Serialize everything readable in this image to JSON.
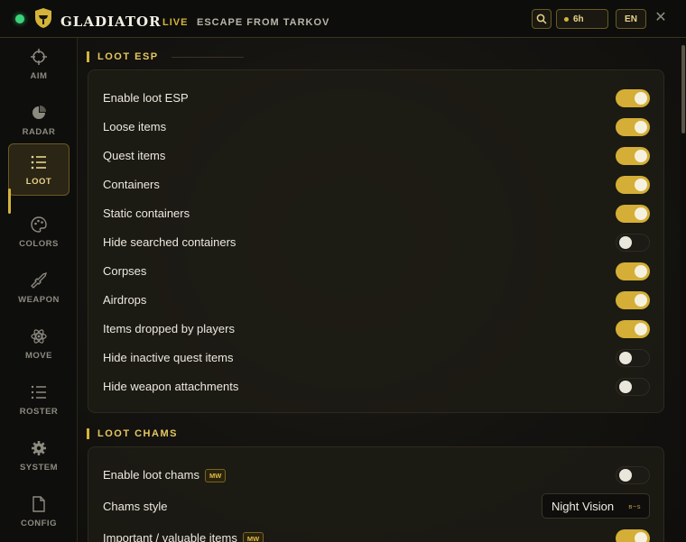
{
  "header": {
    "brand": "GLADIATOR",
    "status": "LIVE",
    "game": "ESCAPE FROM TARKOV",
    "time": "6h",
    "language": "EN",
    "close_glyph": "✕"
  },
  "sidebar": {
    "items": [
      {
        "label": "AIM",
        "icon": "crosshair-icon"
      },
      {
        "label": "RADAR",
        "icon": "radar-icon"
      },
      {
        "label": "LOOT",
        "icon": "list-icon"
      },
      {
        "label": "COLORS",
        "icon": "palette-icon"
      },
      {
        "label": "WEAPON",
        "icon": "rifle-icon"
      },
      {
        "label": "MOVE",
        "icon": "atom-icon"
      },
      {
        "label": "ROSTER",
        "icon": "roster-icon"
      },
      {
        "label": "SYSTEM",
        "icon": "gear-icon"
      },
      {
        "label": "CONFIG",
        "icon": "file-icon"
      }
    ],
    "active": "LOOT"
  },
  "loot_esp": {
    "title": "LOOT ESP",
    "rows": [
      {
        "label": "Enable loot ESP",
        "on": true
      },
      {
        "label": "Loose items",
        "on": true
      },
      {
        "label": "Quest items",
        "on": true
      },
      {
        "label": "Containers",
        "on": true
      },
      {
        "label": "Static containers",
        "on": true
      },
      {
        "label": "Hide searched containers",
        "on": false
      },
      {
        "label": "Corpses",
        "on": true
      },
      {
        "label": "Airdrops",
        "on": true
      },
      {
        "label": "Items dropped by players",
        "on": true
      },
      {
        "label": "Hide inactive quest items",
        "on": false
      },
      {
        "label": "Hide weapon attachments",
        "on": false
      }
    ]
  },
  "loot_chams": {
    "title": "LOOT CHAMS",
    "enable_label": "Enable loot chams",
    "enable_badge": "MW",
    "enable_on": false,
    "style_label": "Chams style",
    "style_value": "Night Vision",
    "style_hint": "в−s",
    "important_label": "Important / valuable items",
    "important_badge": "MW",
    "important_on": true
  },
  "colors": {
    "accent": "#d5b33a",
    "toggle_on": "#d4ae36",
    "background": "#141310"
  }
}
